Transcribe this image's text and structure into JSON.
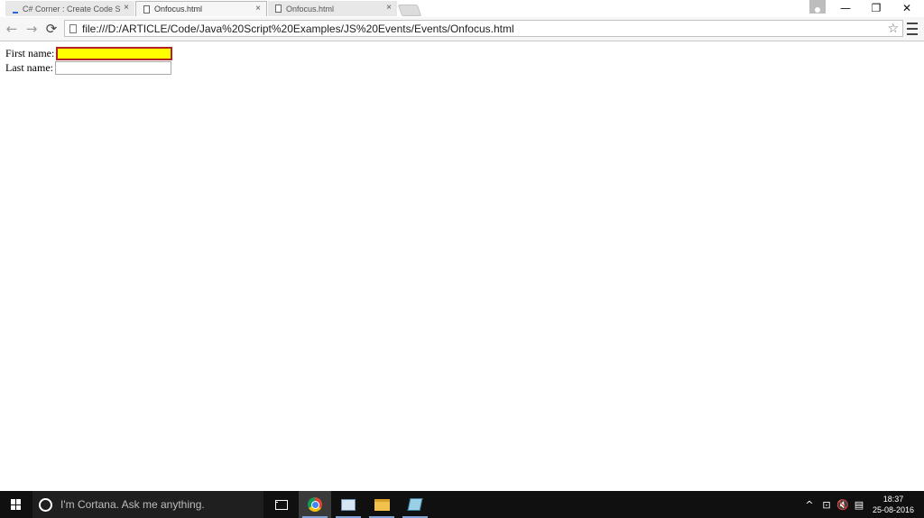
{
  "browser": {
    "tabs": [
      {
        "label": "C# Corner : Create Code S",
        "close": "×"
      },
      {
        "label": "Onfocus.html",
        "close": "×"
      },
      {
        "label": "Onfocus.html",
        "close": "×"
      }
    ],
    "window_controls": {
      "minimize": "—",
      "restore": "❐",
      "close": "✕"
    },
    "nav": {
      "back": "←",
      "forward": "→",
      "reload": "⟳"
    },
    "address_bar": {
      "url": "file:///D:/ARTICLE/Code/Java%20Script%20Examples/JS%20Events/Events/Onfocus.html"
    },
    "bookmark_star": "☆"
  },
  "page": {
    "first_name_label": "First name:",
    "first_name_value": "",
    "last_name_label": "Last name:",
    "last_name_value": "",
    "focus_background": "#ffff00",
    "focus_border": "#b22222"
  },
  "taskbar": {
    "cortana_placeholder": "I'm Cortana. Ask me anything.",
    "tray": {
      "chevron": "^",
      "network": "⊡",
      "volume": "🔇",
      "notifications": "▤"
    },
    "clock": {
      "time": "18:37",
      "date": "25-08-2016"
    }
  }
}
